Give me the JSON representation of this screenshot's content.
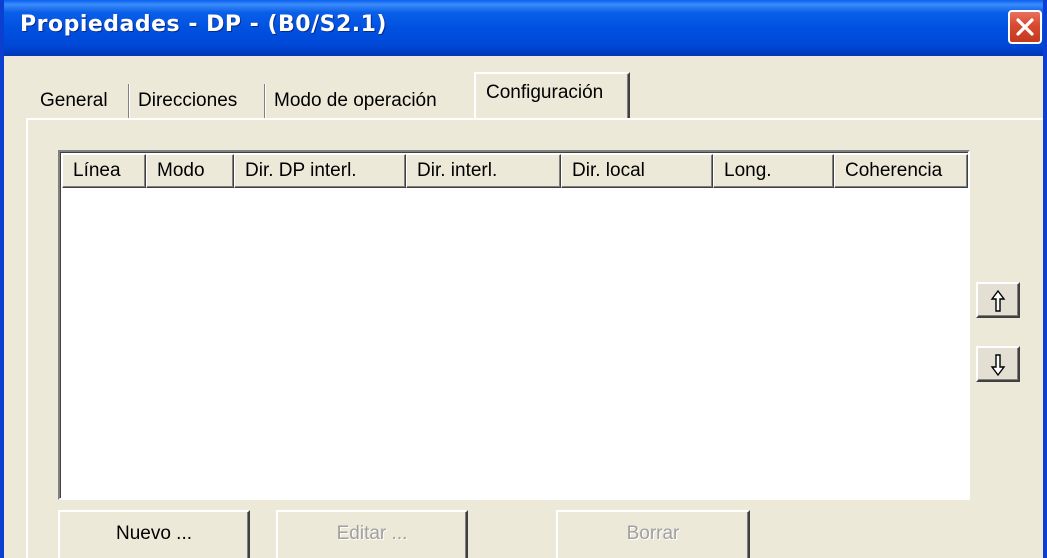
{
  "window": {
    "title": "Propiedades - DP - (B0/S2.1)"
  },
  "tabs": [
    {
      "label": "General",
      "active": false
    },
    {
      "label": "Direcciones",
      "active": false
    },
    {
      "label": "Modo de operación",
      "active": false
    },
    {
      "label": "Configuración",
      "active": true
    }
  ],
  "list": {
    "columns": [
      "Línea",
      "Modo",
      "Dir. DP interl.",
      "Dir. interl.",
      "Dir. local",
      "Long.",
      "Coherencia"
    ],
    "rows": []
  },
  "side_buttons": {
    "move_up_icon": "arrow-up-icon",
    "move_down_icon": "arrow-down-icon"
  },
  "buttons": {
    "new_label": "Nuevo ...",
    "edit_label": "Editar ...",
    "delete_label": "Borrar"
  },
  "colors": {
    "title_bar": "#0051e0",
    "close_button": "#d84a30",
    "dialog_background": "#ece9d8"
  }
}
